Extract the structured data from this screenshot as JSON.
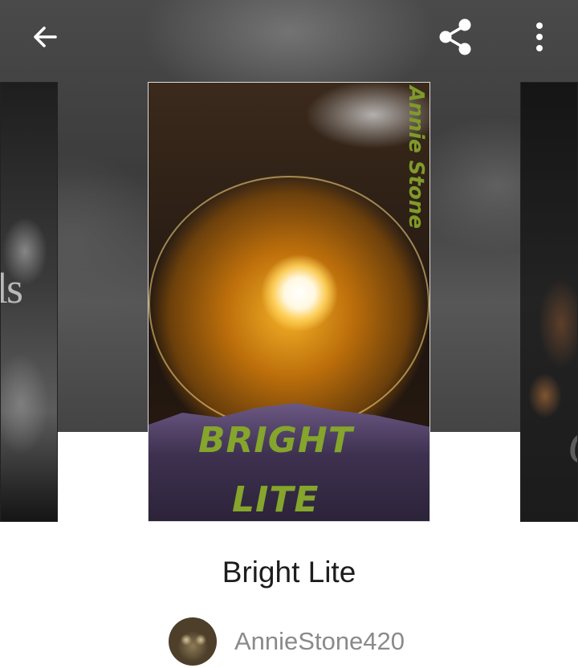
{
  "book": {
    "title": "Bright Lite",
    "cover_title_line1": "BRIGHT",
    "cover_title_line2": "LITE",
    "cover_author": "Annie Stone"
  },
  "author": {
    "username": "AnnieStone420"
  },
  "carousel": {
    "left_peek_text": "ls",
    "right_peek_text": "C"
  },
  "toolbar": {
    "back_icon": "arrow-left",
    "share_icon": "share",
    "more_icon": "vertical-ellipsis"
  },
  "colors": {
    "cover_text": "#85a52c",
    "title_text": "#1d1d1d",
    "author_text": "#8a8a8a"
  }
}
